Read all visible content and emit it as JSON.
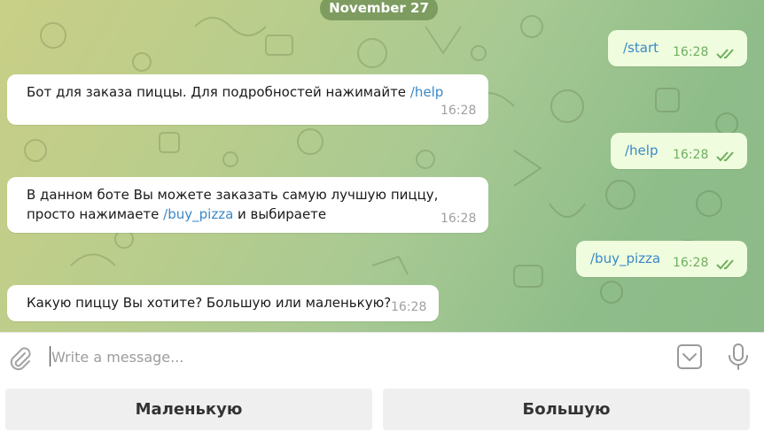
{
  "date_separator": "November 27",
  "messages": [
    {
      "direction": "out",
      "text": "/start",
      "time": "16:28",
      "read": true
    },
    {
      "direction": "in",
      "text_before": "Бот для заказа пиццы. Для подробностей нажимайте ",
      "command": "/help",
      "text_after": "",
      "time": "16:28"
    },
    {
      "direction": "out",
      "text": "/help",
      "time": "16:28",
      "read": true
    },
    {
      "direction": "in",
      "line1": "В данном боте Вы можете заказать самую лучшую пиццу,",
      "line2_before": "просто нажимаете ",
      "command": "/buy_pizza",
      "line2_after": " и выбираете",
      "time": "16:28"
    },
    {
      "direction": "out",
      "text": "/buy_pizza",
      "time": "16:28",
      "read": true
    },
    {
      "direction": "in",
      "text_before": "Какую пиццу Вы хотите? Большую или маленькую?",
      "time": "16:28"
    }
  ],
  "composer": {
    "placeholder": "Write a message...",
    "value": ""
  },
  "reply_keyboard": {
    "buttons": [
      "Маленькую",
      "Большую"
    ]
  },
  "colors": {
    "outgoing_bubble": "#effdde",
    "incoming_bubble": "#ffffff",
    "link": "#3a88c8",
    "read_ticks": "#6fae5f"
  },
  "icons": [
    "paperclip-icon",
    "keyboard-toggle-icon",
    "microphone-icon",
    "double-check-icon"
  ]
}
